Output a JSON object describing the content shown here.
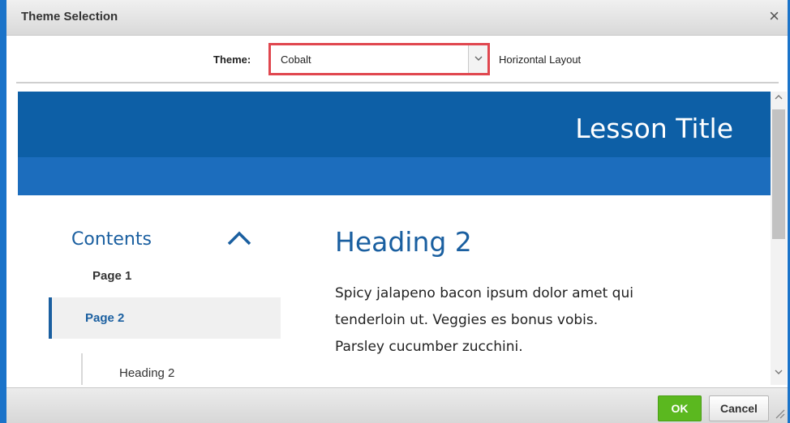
{
  "dialog": {
    "title": "Theme Selection",
    "close_glyph": "×"
  },
  "theme_row": {
    "label": "Theme:",
    "selected_theme": "Cobalt",
    "dropdown_icon": "chevron-down-icon",
    "layout_label": "Horizontal Layout"
  },
  "preview": {
    "lesson_title": "Lesson Title",
    "contents_title": "Contents",
    "nav": {
      "page1": "Page 1",
      "page2": "Page 2",
      "heading2": "Heading 2"
    },
    "heading": "Heading 2",
    "body_lines": [
      "Spicy jalapeno bacon ipsum dolor amet qui",
      "tenderloin ut. Veggies es bonus vobis.",
      "Parsley cucumber zucchini."
    ]
  },
  "footer": {
    "ok_label": "OK",
    "cancel_label": "Cancel"
  },
  "colors": {
    "accent_blue": "#1a5fa0",
    "banner_dark": "#0d5fa6",
    "banner_light": "#1c6dbd",
    "ok_green": "#5bb81f",
    "highlight_red": "#e0474f"
  }
}
